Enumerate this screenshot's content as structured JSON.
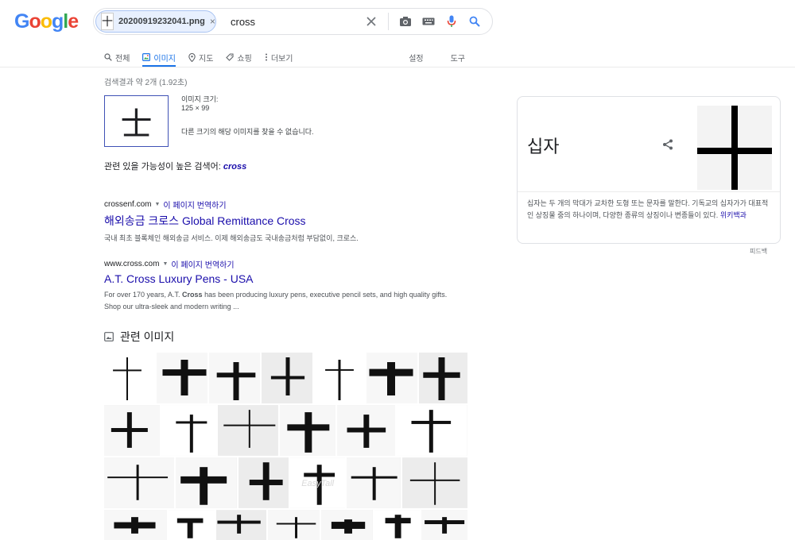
{
  "logo": {
    "letters": [
      "G",
      "o",
      "o",
      "g",
      "l",
      "e"
    ],
    "colors": [
      "#4285f4",
      "#ea4335",
      "#fbbc05",
      "#4285f4",
      "#34a853",
      "#ea4335"
    ]
  },
  "search": {
    "chip_thumb": "十",
    "chip_filename": "20200919232041.png",
    "chip_close": "×",
    "query": "cross",
    "icons": [
      "clear-icon",
      "camera-icon",
      "keyboard-icon",
      "mic-icon",
      "search-icon"
    ]
  },
  "tabs": [
    {
      "label": "전체",
      "icon": "search-icon",
      "active": false
    },
    {
      "label": "이미지",
      "icon": "image-icon",
      "active": true
    },
    {
      "label": "지도",
      "icon": "map-pin-icon",
      "active": false
    },
    {
      "label": "쇼핑",
      "icon": "tag-icon",
      "active": false
    },
    {
      "label": "더보기",
      "icon": "more-vertical-icon",
      "active": false
    }
  ],
  "tabs_right": {
    "settings": "설정",
    "tools": "도구"
  },
  "result_stats": "검색결과 약 2개 (1.92초)",
  "image_info": {
    "thumb_glyph": "士",
    "size_label": "이미지 크기:",
    "size_value": "125 × 99",
    "other_sizes": "다른 크기의 해당 이미지를 찾을 수 없습니다."
  },
  "related_query": {
    "prefix": "관련 있을 가능성이 높은 검색어:",
    "term": "cross"
  },
  "results": [
    {
      "url": "crossenf.com",
      "translate": "이 페이지 번역하기",
      "title": "해외송금 크로스 Global Remittance Cross",
      "snippet": "국내 최초 블록체인 해외송금 서비스. 이제 해외송금도 국내송금처럼 부담없이, 크로스."
    },
    {
      "url": "www.cross.com",
      "translate": "이 페이지 번역하기",
      "title": "A.T. Cross Luxury Pens - USA",
      "snippet_pre": "For over 170 years, A.T. ",
      "snippet_bold": "Cross",
      "snippet_post": " has been producing luxury pens, executive pencil sets, and high quality gifts. Shop our ultra-sleek and modern writing ..."
    }
  ],
  "related_images": {
    "heading": "관련 이미지",
    "rows": [
      {
        "widths": [
          64,
          64,
          64,
          64,
          64,
          64,
          61
        ],
        "height": 64
      },
      {
        "widths": [
          70,
          70,
          76,
          70,
          74,
          89
        ],
        "height": 64
      },
      {
        "widths": [
          89,
          77,
          64,
          70,
          68,
          83
        ],
        "height": 64
      },
      {
        "widths": [
          80,
          59,
          64,
          66,
          65,
          58,
          59
        ],
        "height": 40
      }
    ],
    "watermark": "EasyTall"
  },
  "knowledge_panel": {
    "title": "십자",
    "desc": "십자는 두 개의 막대가 교차한 도형 또는 문자를 말한다. 기독교의 십자가가 대표적인 상징물 중의 하나이며, 다양한 종류의 상징이나 변종들이 있다.",
    "source": "위키백과"
  },
  "feedback": "피드백"
}
